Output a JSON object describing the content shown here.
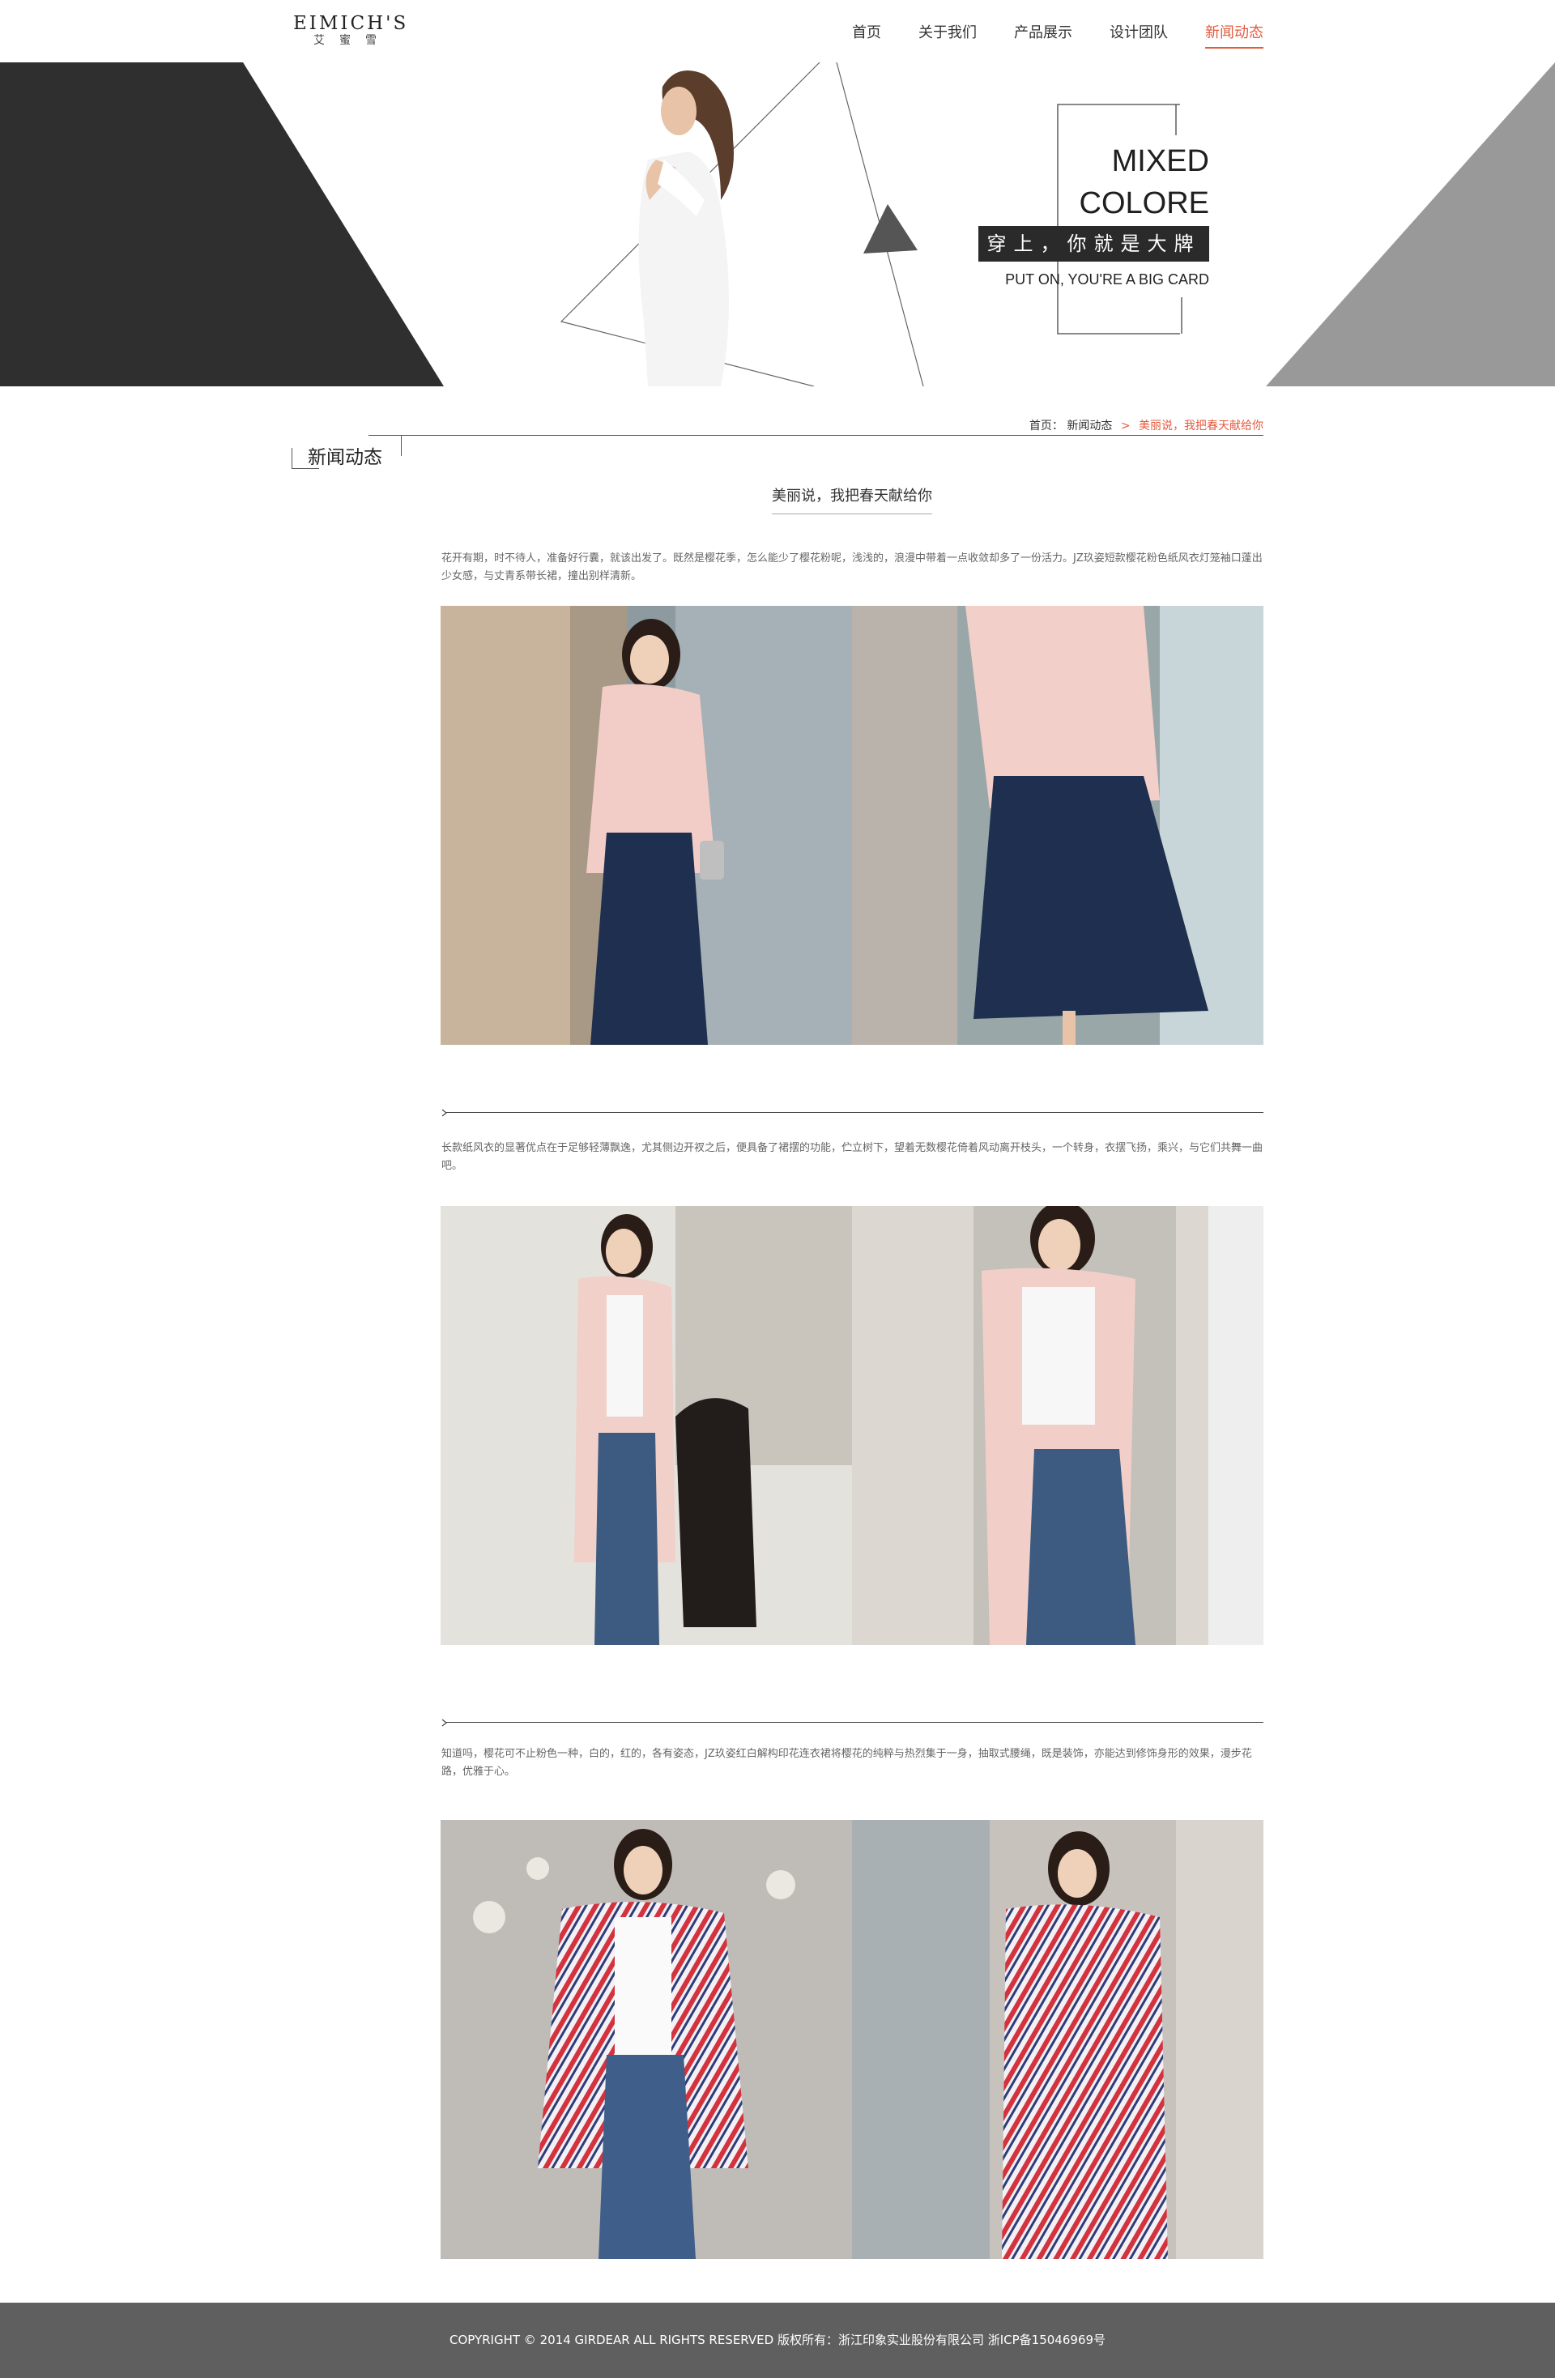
{
  "brand": {
    "name_en": "EIMICH'S",
    "name_cn": "艾蜜雪"
  },
  "nav": [
    {
      "label": "首页",
      "active": false
    },
    {
      "label": "关于我们",
      "active": false
    },
    {
      "label": "产品展示",
      "active": false
    },
    {
      "label": "设计团队",
      "active": false
    },
    {
      "label": "新闻动态",
      "active": true
    }
  ],
  "banner": {
    "title_line1": "MIXED",
    "title_line2": "COLORE",
    "slogan": "穿上，你就是大牌",
    "subtitle": "PUT ON, YOU'RE A BIG CARD"
  },
  "breadcrumb": {
    "home": "首页：",
    "section": "新闻动态",
    "separator": ">",
    "current": "美丽说，我把春天献给你"
  },
  "section_title": "新闻动态",
  "article": {
    "title": "美丽说，我把春天献给你",
    "paragraphs": [
      "花开有期，时不待人，准备好行囊，就该出发了。既然是樱花季，怎么能少了樱花粉呢，浅浅的，浪漫中带着一点收敛却多了一份活力。JZ玖姿短款樱花粉色纸风衣灯笼袖口蓬出少女感，与丈青系带长裙，撞出别样清新。",
      "长款纸风衣的显著优点在于足够轻薄飘逸，尤其侧边开衩之后，便具备了裙摆的功能，伫立树下，望着无数樱花倚着风动离开枝头，一个转身，衣摆飞扬，乘兴，与它们共舞一曲吧。",
      "知道吗，樱花可不止粉色一种，白的，红的，各有姿态，JZ玖姿红白解构印花连衣裙将樱花的纯粹与热烈集于一身，抽取式腰绳，既是装饰，亦能达到修饰身形的效果，漫步花路，优雅于心。"
    ]
  },
  "colors": {
    "accent": "#e45a3e",
    "dark": "#2f2f2f",
    "gray": "#999999",
    "footer_bg": "#5f5f5f"
  },
  "footer": {
    "text": "COPYRIGHT © 2014 GIRDEAR ALL RIGHTS RESERVED 版权所有：浙江印象实业股份有限公司  浙ICP备15046969号"
  }
}
